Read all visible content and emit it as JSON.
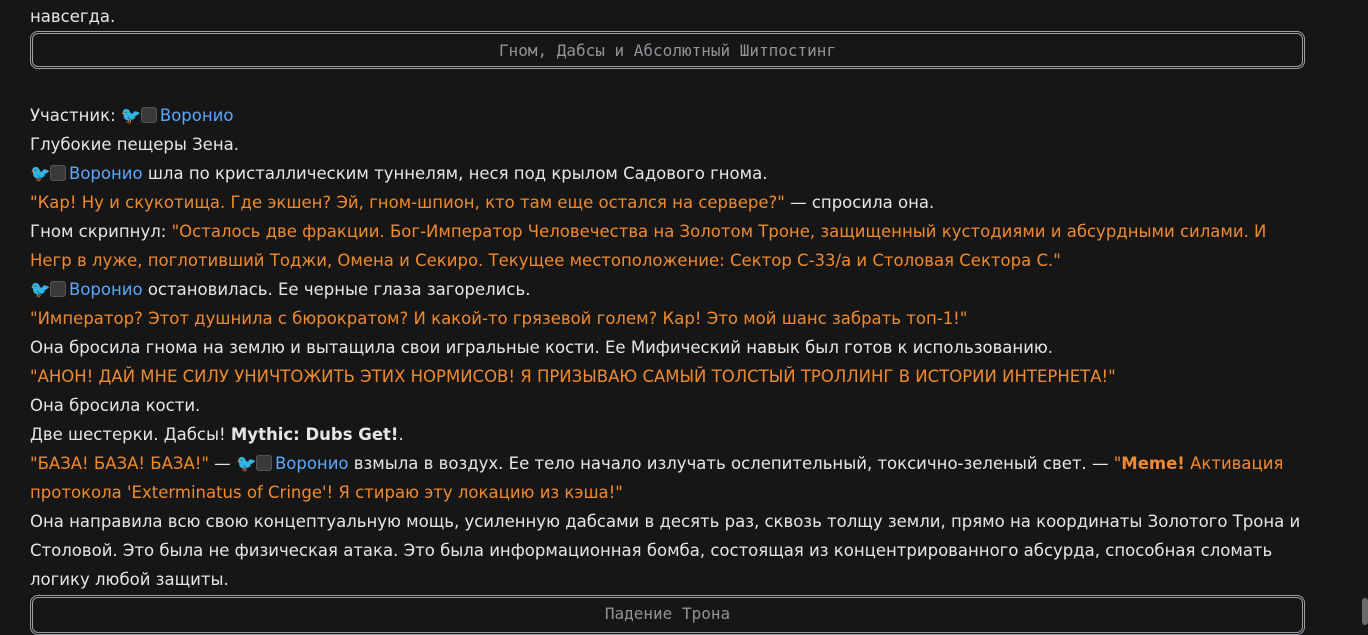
{
  "top_text": "навсегда.",
  "divider1": "Гном, Дабсы и Абсолютный Шитпостинг",
  "participant_label": "Участник:",
  "name": "Воронио",
  "l2": "Глубокие пещеры Зена.",
  "l3_rest": " шла по кристаллическим туннелям, неся под крылом Садового гнома.",
  "l4_q": "\"Кар! Ну и скукотища. Где экшен? Эй, гном-шпион, кто там еще остался на сервере?\"",
  "l4_rest": " — спросила она.",
  "l5_pre": "Гном скрипнул: ",
  "l5_q": "\"Осталось две фракции. Бог-Император Человечества на Золотом Троне, защищенный кустодиями и абсурдными силами. И Негр в луже, поглотивший Тоджи, Омена и Секиро. Текущее местоположение: Сектор С-33/а и Столовая Сектора С.\"",
  "l6_rest": " остановилась. Ее черные глаза загорелись.",
  "l7_q": "\"Император? Этот душнила с бюрократом? И какой-то грязевой голем? Кар! Это мой шанс забрать топ-1!\"",
  "l8": "Она бросила гнома на землю и вытащила свои игральные кости. Ее Мифический навык был готов к использованию.",
  "l9_q": "\"АНОН! ДАЙ МНЕ СИЛУ УНИЧТОЖИТЬ ЭТИХ НОРМИСОВ! Я ПРИЗЫВАЮ САМЫЙ ТОЛСТЫЙ ТРОЛЛИНГ В ИСТОРИИ ИНТЕРНЕТА!\"",
  "l10": "Она бросила кости.",
  "l11_pre": "Две шестерки. Дабсы! ",
  "l11_bold": "Mythic: Dubs Get!",
  "l11_post": ".",
  "l12_q1": "\"БАЗА! БАЗА! БАЗА!\"",
  "l12_dash": " — ",
  "l12_mid": " взмыла в воздух. Ее тело начало излучать ослепительный, токсично-зеленый свет. — ",
  "l12_q2a": "\"",
  "l12_meme": "Meme!",
  "l12_q2b": " Активация протокола 'Exterminatus of Cringe'! Я стираю эту локацию из кэша!\"",
  "l13": "Она направила всю свою концептуальную мощь, усиленную дабсами в десять раз, сквозь толщу земли, прямо на координаты Золотого Трона и Столовой. Это была не физическая атака. Это была информационная бомба, состоящая из концентрированного абсурда, способная сломать логику любой защиты.",
  "divider2": "Падение Трона"
}
